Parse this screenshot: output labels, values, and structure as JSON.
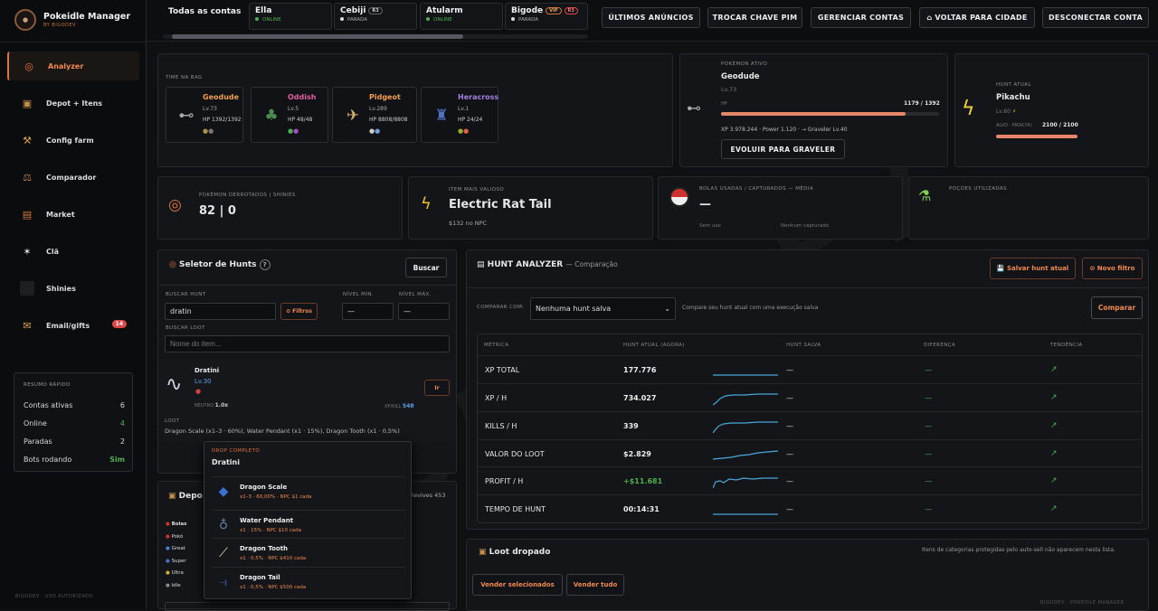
{
  "brand": {
    "title": "Pokeidle Manager",
    "subtitle": "BY BIGODEV",
    "logo_text": "BIGO"
  },
  "sidebar": {
    "items": [
      {
        "label": "Analyzer",
        "icon": "target-icon",
        "active": true
      },
      {
        "label": "Depot + Itens",
        "icon": "box-icon"
      },
      {
        "label": "Config farm",
        "icon": "config-icon"
      },
      {
        "label": "Comparador",
        "icon": "compare-icon"
      },
      {
        "label": "Market",
        "icon": "market-icon"
      },
      {
        "label": "Clã",
        "icon": "clan-icon"
      },
      {
        "label": "Shinies",
        "icon": "shiny-icon"
      },
      {
        "label": "Email/gifts",
        "icon": "gift-icon",
        "badge": "14"
      }
    ],
    "summary": {
      "title": "RESUMO RÁPIDO",
      "rows": [
        {
          "label": "Contas ativas",
          "value": "6"
        },
        {
          "label": "Online",
          "value": "4"
        },
        {
          "label": "Paradas",
          "value": "2"
        },
        {
          "label": "Bots rodando",
          "value": "Sim"
        }
      ]
    },
    "footer": "BIGODEV · USO AUTORIZADO"
  },
  "topbar": {
    "all_accounts": "Todas as contas",
    "accounts": [
      {
        "name": "Ella",
        "status": "ONLINE",
        "tags": []
      },
      {
        "name": "Cebiji",
        "status": "PARADA",
        "tags": [
          "R3"
        ]
      },
      {
        "name": "Atularm",
        "status": "ONLINE",
        "tags": []
      },
      {
        "name": "Bigode",
        "status": "PARADA",
        "tags": [
          "VIP",
          "R3"
        ]
      }
    ],
    "buttons": [
      "ÚLTIMOS ANÚNCIOS",
      "TROCAR CHAVE PIM",
      "GERENCIAR CONTAS",
      "⌂ VOLTAR PARA CIDADE",
      "DESCONECTAR CONTA"
    ]
  },
  "team": {
    "title": "TIME NA BAG",
    "members": [
      {
        "name": "Geodude",
        "level": "Lv.73",
        "hp": "HP 1392/1392"
      },
      {
        "name": "Oddish",
        "level": "Lv.5",
        "hp": "HP 48/48"
      },
      {
        "name": "Pidgeot",
        "level": "Lv.289",
        "hp": "HP 8808/8808"
      },
      {
        "name": "Heracross",
        "level": "Lv.1",
        "hp": "HP 24/24"
      }
    ]
  },
  "active": {
    "title": "POKÉMON ATIVO",
    "name": "Geodude",
    "level": "Lv.73",
    "hp_label": "HP",
    "hp_value": "1179 / 1392",
    "hp_fraction": 0.847,
    "xp": "XP 3.978.244 · Power 1.120 · → Graveler Lv.40",
    "evolve": "EVOLUIR PARA GRAVELER"
  },
  "hunt": {
    "title": "HUNT ATUAL",
    "name": "Pikachu",
    "level": "Lv.60",
    "target_label": "ALVO · PIKACHU",
    "target_value": "2100 / 2100",
    "target_fraction": 1.0
  },
  "stats": {
    "defeated": {
      "label": "POKÉMON DERROTADOS | SHINIES",
      "value": "82 | 0"
    },
    "valuable": {
      "label": "ITEM MAIS VALIOSO",
      "value": "Electric Rat Tail",
      "sub": "$132 no NPC"
    },
    "balls": {
      "label": "BOLAS USADAS / CAPTURADOS — MÉDIA",
      "value": "—",
      "sub1": "Sem uso",
      "sub2": "Nenhum capturado"
    },
    "potions": {
      "label": "POÇÕES UTILIZADAS"
    }
  },
  "selector": {
    "title": "Seletor de Hunts",
    "help": "?",
    "search_btn": "Buscar",
    "hunt_label": "BUSCAR HUNT",
    "hunt_value": "dratin",
    "filter_btn": "⊘ Filtros",
    "min_label": "NÍVEL MÍN.",
    "min_value": "—",
    "max_label": "NÍVEL MÁX.",
    "max_value": "—",
    "loot_label": "BUSCAR LOOT",
    "loot_placeholder": "Nome do item...",
    "result": {
      "name": "Dratini",
      "level": "Lv.30",
      "neutral": "NEUTRO",
      "neutral_val": "1.0x",
      "xpkill_label": "XP/KILL",
      "xpkill_val": "548",
      "go": "Ir",
      "loot_label": "LOOT",
      "loot": "Dragon Scale (x1–3 · 60%), Water Pendant (x1 · 15%), Dragon Tooth (x1 · 0,5%)"
    }
  },
  "dropdown": {
    "label": "DROP COMPLETO",
    "title": "Dratini",
    "items": [
      {
        "name": "Dragon Scale",
        "detail": "x1–3 · 60,00% · NPC $1 cada"
      },
      {
        "name": "Water Pendant",
        "detail": "x1 · 15% · NPC $10 cada"
      },
      {
        "name": "Dragon Tooth",
        "detail": "x1 · 0,5% · NPC $410 cada"
      },
      {
        "name": "Dragon Tail",
        "detail": "x1 · 0,5% · NPC $500 cada"
      }
    ]
  },
  "depot": {
    "title": "Depo",
    "revives": "Revives 453",
    "rows": [
      "Bolas",
      "Pokó",
      "Great",
      "Super",
      "Ultra",
      "Idle"
    ]
  },
  "analyzer": {
    "title": "HUNT ANALYZER",
    "subtitle": "— Comparação",
    "save_btn": "💾 Salvar hunt atual",
    "new_btn": "⊘ Novo filtro",
    "compare_label": "COMPARAR COM:",
    "compare_value": "Nenhuma hunt salva",
    "compare_hint": "Compare seu hunt atual com uma execução salva",
    "compare_btn": "Comparar",
    "headers": [
      "MÉTRICA",
      "HUNT ATUAL (AGORA)",
      "HUNT SALVA",
      "DIFERENÇA",
      "TENDÊNCIA"
    ],
    "rows": [
      {
        "metric": "XP TOTAL",
        "value": "177.776",
        "saved": "—",
        "diff": "—",
        "trend": "↗"
      },
      {
        "metric": "XP / H",
        "value": "734.027",
        "saved": "—",
        "diff": "—",
        "trend": "↗"
      },
      {
        "metric": "KILLS / H",
        "value": "339",
        "saved": "—",
        "diff": "—",
        "trend": "↗"
      },
      {
        "metric": "VALOR DO LOOT",
        "value": "$2.829",
        "saved": "—",
        "diff": "—",
        "trend": "↗"
      },
      {
        "metric": "PROFIT / H",
        "value": "+$11.681",
        "saved": "—",
        "diff": "—",
        "trend": "↗"
      },
      {
        "metric": "TEMPO DE HUNT",
        "value": "00:14:31",
        "saved": "—",
        "diff": "—",
        "trend": "↗"
      }
    ]
  },
  "loot": {
    "title": "Loot dropado",
    "hint": "Itens de categorias protegidas pelo auto-sell não aparecem nesta lista.",
    "sell_selected": "Vender selecionados",
    "sell_all": "Vender tudo",
    "footer_mark": "BIGODEV · POKEIDLE MANAGER"
  },
  "colors": {
    "accent": "#e0733e",
    "online": "#4caf50",
    "hp": "#e8866a"
  }
}
